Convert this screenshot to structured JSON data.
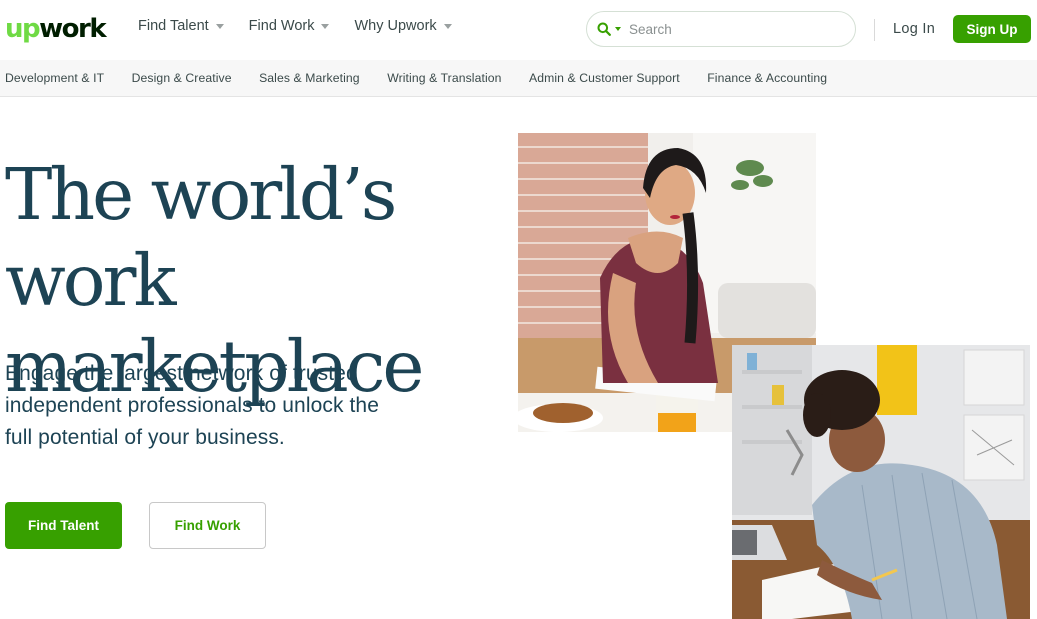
{
  "header": {
    "logo_up": "up",
    "logo_work": "work",
    "nav": [
      {
        "label": "Find Talent"
      },
      {
        "label": "Find Work"
      },
      {
        "label": "Why Upwork"
      }
    ],
    "search_placeholder": "Search",
    "login_label": "Log In",
    "signup_label": "Sign Up"
  },
  "categories": [
    "Development & IT",
    "Design & Creative",
    "Sales & Marketing",
    "Writing & Translation",
    "Admin & Customer Support",
    "Finance & Accounting"
  ],
  "hero": {
    "headline_line1": "The world’s work",
    "headline_line2": "marketplace",
    "subtext": "Engage the largest network of trusted independent professionals to unlock the full potential of your business.",
    "cta_primary": "Find Talent",
    "cta_secondary": "Find Work"
  },
  "colors": {
    "brand_green": "#37a000",
    "logo_green": "#6fda44",
    "headline": "#1d4354"
  }
}
